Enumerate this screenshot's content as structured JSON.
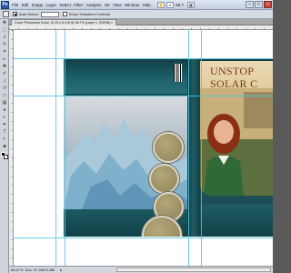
{
  "app": {
    "logo": "Ps"
  },
  "menu": [
    "File",
    "Edit",
    "Image",
    "Layer",
    "Select",
    "Filter",
    "Analysis",
    "3D",
    "View",
    "Window",
    "Help"
  ],
  "zoom": "66.7",
  "window_controls": {
    "minimize": "–",
    "maximize": "□",
    "close": "×"
  },
  "options_bar": {
    "auto_select_label": "Auto-Select:",
    "transform_label": "Show Transform Controls"
  },
  "document_tab": {
    "label": "Cover Photobook Cover 12.25 x 6.4 tif @ 66.7% (Layer 1, RGB/8) ×"
  },
  "cover": {
    "title_line1": "UNSTOP",
    "title_line2": "SOLAR C"
  },
  "status": {
    "zoom": "66.67%",
    "doc": "Doc: 37.4M/74.8M"
  },
  "icons": [
    "photoshop-logo",
    "move-tool-icon",
    "marquee-tool-icon",
    "lasso-tool-icon",
    "crop-tool-icon",
    "brush-tool-icon",
    "type-tool-icon",
    "zoom-tool-icon"
  ],
  "colors": {
    "cover_teal": "#1c4f55",
    "title_brown": "#7b3b12",
    "guide_cyan": "#4fc6e0",
    "circle_fill": "#9c8f62"
  }
}
